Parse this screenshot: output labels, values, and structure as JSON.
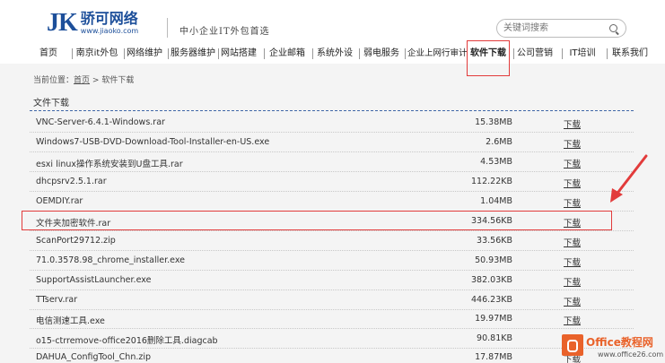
{
  "brand": {
    "logo_mark": "JK",
    "name_cn": "骄可网络",
    "url": "www.jiaoko.com",
    "slogan": "中小企业IT外包首选"
  },
  "search": {
    "placeholder": "关键词搜索"
  },
  "nav": {
    "items": [
      {
        "label": "首页"
      },
      {
        "label": "南京it外包"
      },
      {
        "label": "网络维护"
      },
      {
        "label": "服务器维护"
      },
      {
        "label": "网站搭建"
      },
      {
        "label": "企业邮箱"
      },
      {
        "label": "系统外设"
      },
      {
        "label": "弱电服务"
      },
      {
        "label": "企业上网行审计"
      },
      {
        "label": "软件下载"
      },
      {
        "label": "公司营销"
      },
      {
        "label": "IT培训"
      },
      {
        "label": "联系我们"
      }
    ],
    "active_index": 9
  },
  "breadcrumb": {
    "prefix": "当前位置：",
    "home": "首页",
    "separator": ">",
    "current": "软件下载"
  },
  "section": {
    "title": "文件下载"
  },
  "files": [
    {
      "name": "VNC-Server-6.4.1-Windows.rar",
      "size": "15.38MB",
      "action": "下载"
    },
    {
      "name": "Windows7-USB-DVD-Download-Tool-Installer-en-US.exe",
      "size": "2.6MB",
      "action": "下载"
    },
    {
      "name": "esxi linux操作系统安装到U盘工具.rar",
      "size": "4.53MB",
      "action": "下载"
    },
    {
      "name": "dhcpsrv2.5.1.rar",
      "size": "112.22KB",
      "action": "下载"
    },
    {
      "name": "OEMDIY.rar",
      "size": "1.04MB",
      "action": "下载"
    },
    {
      "name": "文件夹加密软件.rar",
      "size": "334.56KB",
      "action": "下载"
    },
    {
      "name": "ScanPort29712.zip",
      "size": "33.56KB",
      "action": "下载"
    },
    {
      "name": "71.0.3578.98_chrome_installer.exe",
      "size": "50.93MB",
      "action": "下载"
    },
    {
      "name": "SupportAssistLauncher.exe",
      "size": "382.03KB",
      "action": "下载"
    },
    {
      "name": "TTserv.rar",
      "size": "446.23KB",
      "action": "下载"
    },
    {
      "name": "电信测速工具.exe",
      "size": "19.97MB",
      "action": "下载"
    },
    {
      "name": "o15-ctrremove-office2016删除工具.diagcab",
      "size": "90.81KB",
      "action": "下载"
    },
    {
      "name": "DAHUA_ConfigTool_Chn.zip",
      "size": "17.87MB",
      "action": "下载"
    }
  ],
  "highlighted_file_index": 5,
  "watermark": {
    "text": "Office教程网",
    "url": "www.office26.com"
  },
  "colors": {
    "brand_blue": "#1d4f9a",
    "highlight_red": "#e23b3b",
    "watermark_orange": "#e9622a",
    "section_line": "#3f66a6"
  }
}
